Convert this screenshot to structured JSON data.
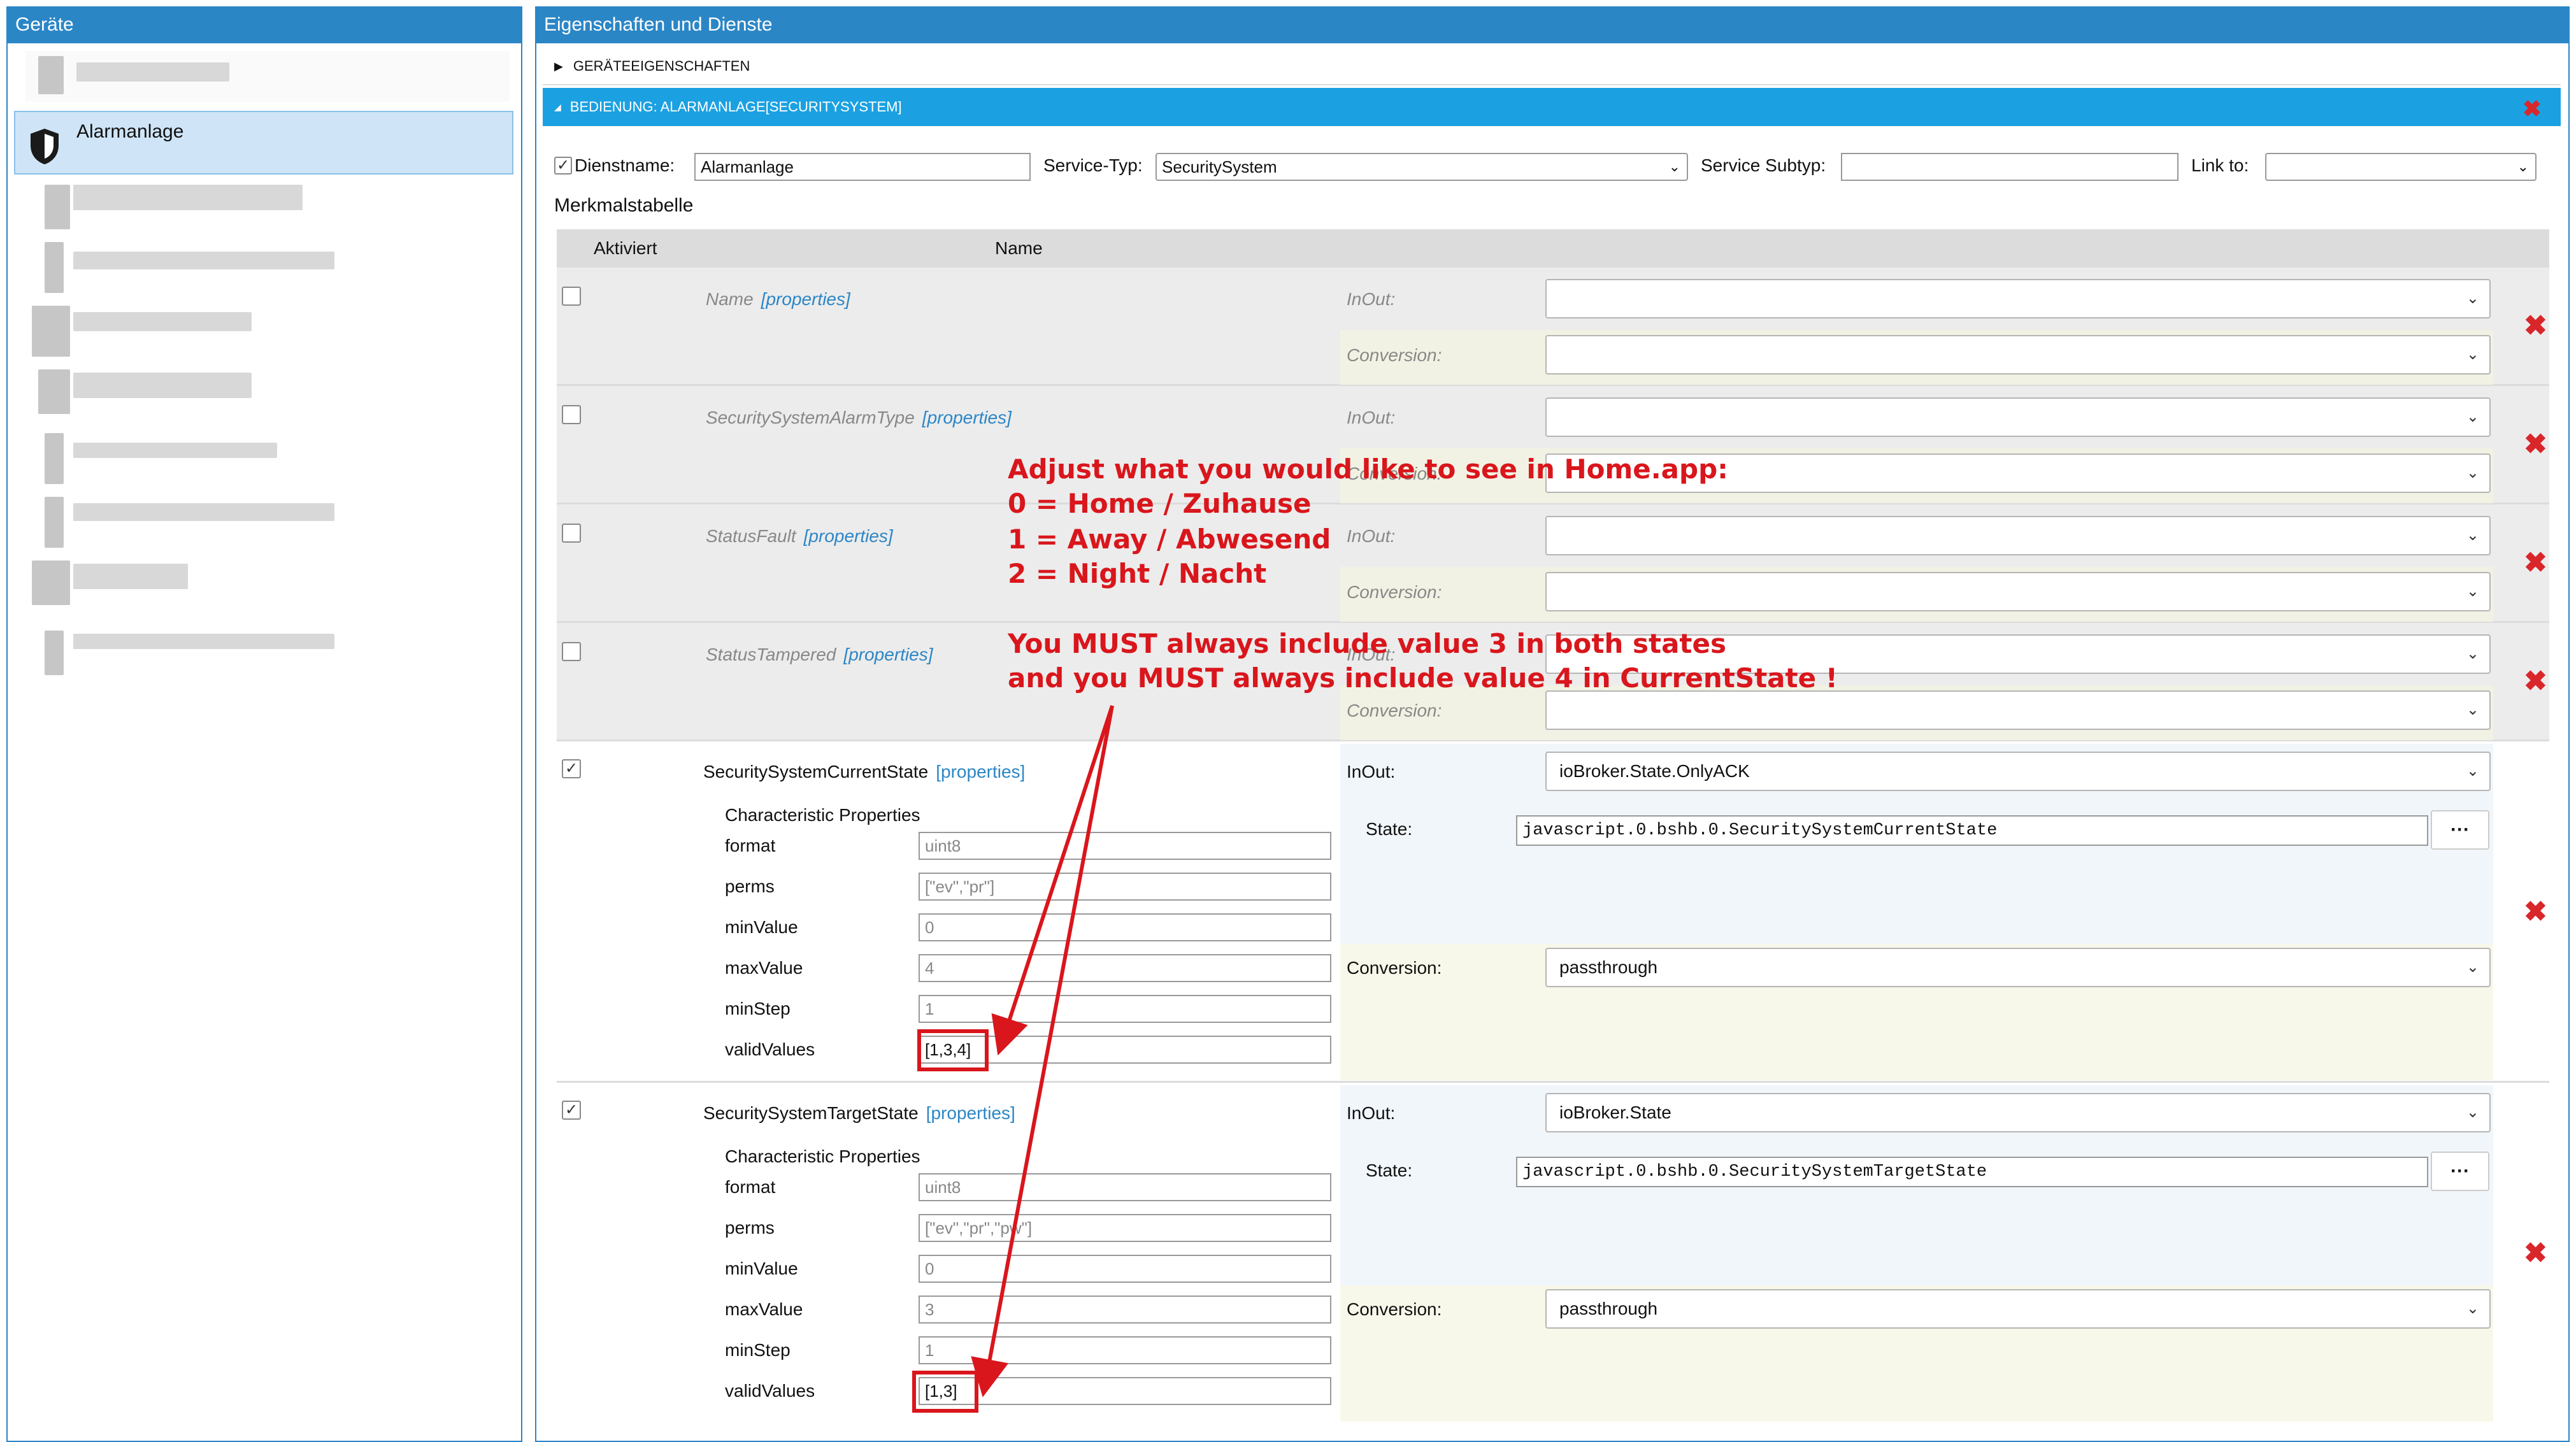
{
  "left_panel": {
    "title": "Geräte",
    "selected_device": "Alarmanlage"
  },
  "right_panel": {
    "title": "Eigenschaften und Dienste",
    "section_collapsed": "GERÄTEEIGENSCHAFTEN",
    "section_expanded": "BEDIENUNG: ALARMANLAGE[SECURITYSYSTEM]"
  },
  "service_form": {
    "dienstname_label": "Dienstname:",
    "dienstname_value": "Alarmanlage",
    "service_typ_label": "Service-Typ:",
    "service_typ_value": "SecuritySystem",
    "service_subtyp_label": "Service Subtyp:",
    "service_subtyp_value": "",
    "link_to_label": "Link to:",
    "link_to_value": ""
  },
  "table": {
    "title": "Merkmalstabelle",
    "col_aktiviert": "Aktiviert",
    "col_name": "Name"
  },
  "labels": {
    "inout": "InOut:",
    "conversion": "Conversion:",
    "state": "State:",
    "properties": "[properties]",
    "char_props": "Characteristic Properties",
    "format": "format",
    "perms": "perms",
    "minValue": "minValue",
    "maxValue": "maxValue",
    "minStep": "minStep",
    "validValues": "validValues",
    "dots": "···"
  },
  "inactive_rows": [
    {
      "name": "Name"
    },
    {
      "name": "SecuritySystemAlarmType"
    },
    {
      "name": "StatusFault"
    },
    {
      "name": "StatusTampered"
    }
  ],
  "current_state": {
    "name": "SecuritySystemCurrentState",
    "inout": "ioBroker.State.OnlyACK",
    "state": "javascript.0.bshb.0.SecuritySystemCurrentState",
    "conversion": "passthrough",
    "format": "uint8",
    "perms": "[\"ev\",\"pr\"]",
    "minValue": "0",
    "maxValue": "4",
    "minStep": "1",
    "validValues": "[1,3,4]"
  },
  "target_state": {
    "name": "SecuritySystemTargetState",
    "inout": "ioBroker.State",
    "state": "javascript.0.bshb.0.SecuritySystemTargetState",
    "conversion": "passthrough",
    "format": "uint8",
    "perms": "[\"ev\",\"pr\",\"pw\"]",
    "minValue": "0",
    "maxValue": "3",
    "minStep": "1",
    "validValues": "[1,3]"
  },
  "annotation": {
    "line1": "Adjust what you would like to see in Home.app:",
    "line2": "0 = Home / Zuhause",
    "line3": "1 = Away / Abwesend",
    "line4": "2 = Night / Nacht",
    "line5": "You MUST always include value 3 in both states",
    "line6": "and you MUST always include value 4 in CurrentState !"
  },
  "colors": {
    "header_blue": "#2b86c6",
    "expanded_blue": "#1ba1e2",
    "selected_bg": "#cfe5f7",
    "delete_red": "#d9262b",
    "annotation_red": "#d9161c"
  }
}
